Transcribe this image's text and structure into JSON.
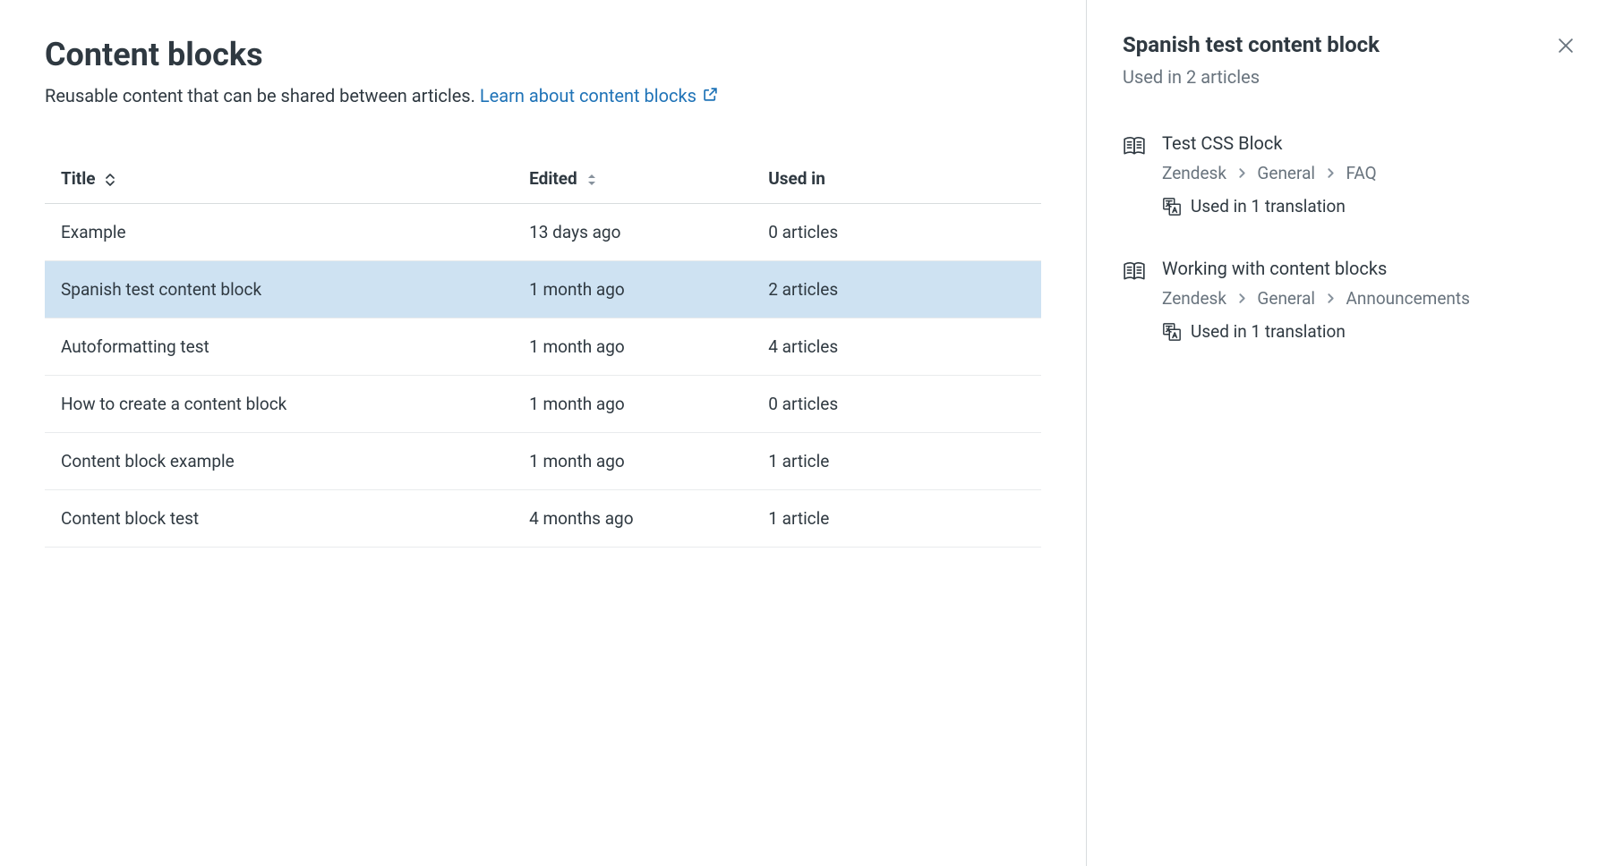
{
  "page": {
    "title": "Content blocks",
    "description_prefix": "Reusable content that can be shared between articles. ",
    "learn_link": "Learn about content blocks"
  },
  "table": {
    "headers": {
      "title": "Title",
      "edited": "Edited",
      "used_in": "Used in"
    },
    "rows": [
      {
        "title": "Example",
        "edited": "13 days ago",
        "used_in": "0 articles",
        "selected": false
      },
      {
        "title": "Spanish test content block",
        "edited": "1 month ago",
        "used_in": "2 articles",
        "selected": true
      },
      {
        "title": "Autoformatting test",
        "edited": "1 month ago",
        "used_in": "4 articles",
        "selected": false
      },
      {
        "title": "How to create a content block",
        "edited": "1 month ago",
        "used_in": "0 articles",
        "selected": false
      },
      {
        "title": "Content block example",
        "edited": "1 month ago",
        "used_in": "1 article",
        "selected": false
      },
      {
        "title": "Content block test",
        "edited": "4 months ago",
        "used_in": "1 article",
        "selected": false
      }
    ]
  },
  "panel": {
    "title": "Spanish test content block",
    "subtitle": "Used in 2 articles",
    "usages": [
      {
        "title": "Test CSS Block",
        "crumbs": [
          "Zendesk",
          "General",
          "FAQ"
        ],
        "translation": "Used in 1 translation"
      },
      {
        "title": "Working with content blocks",
        "crumbs": [
          "Zendesk",
          "General",
          "Announcements"
        ],
        "translation": "Used in 1 translation"
      }
    ]
  }
}
